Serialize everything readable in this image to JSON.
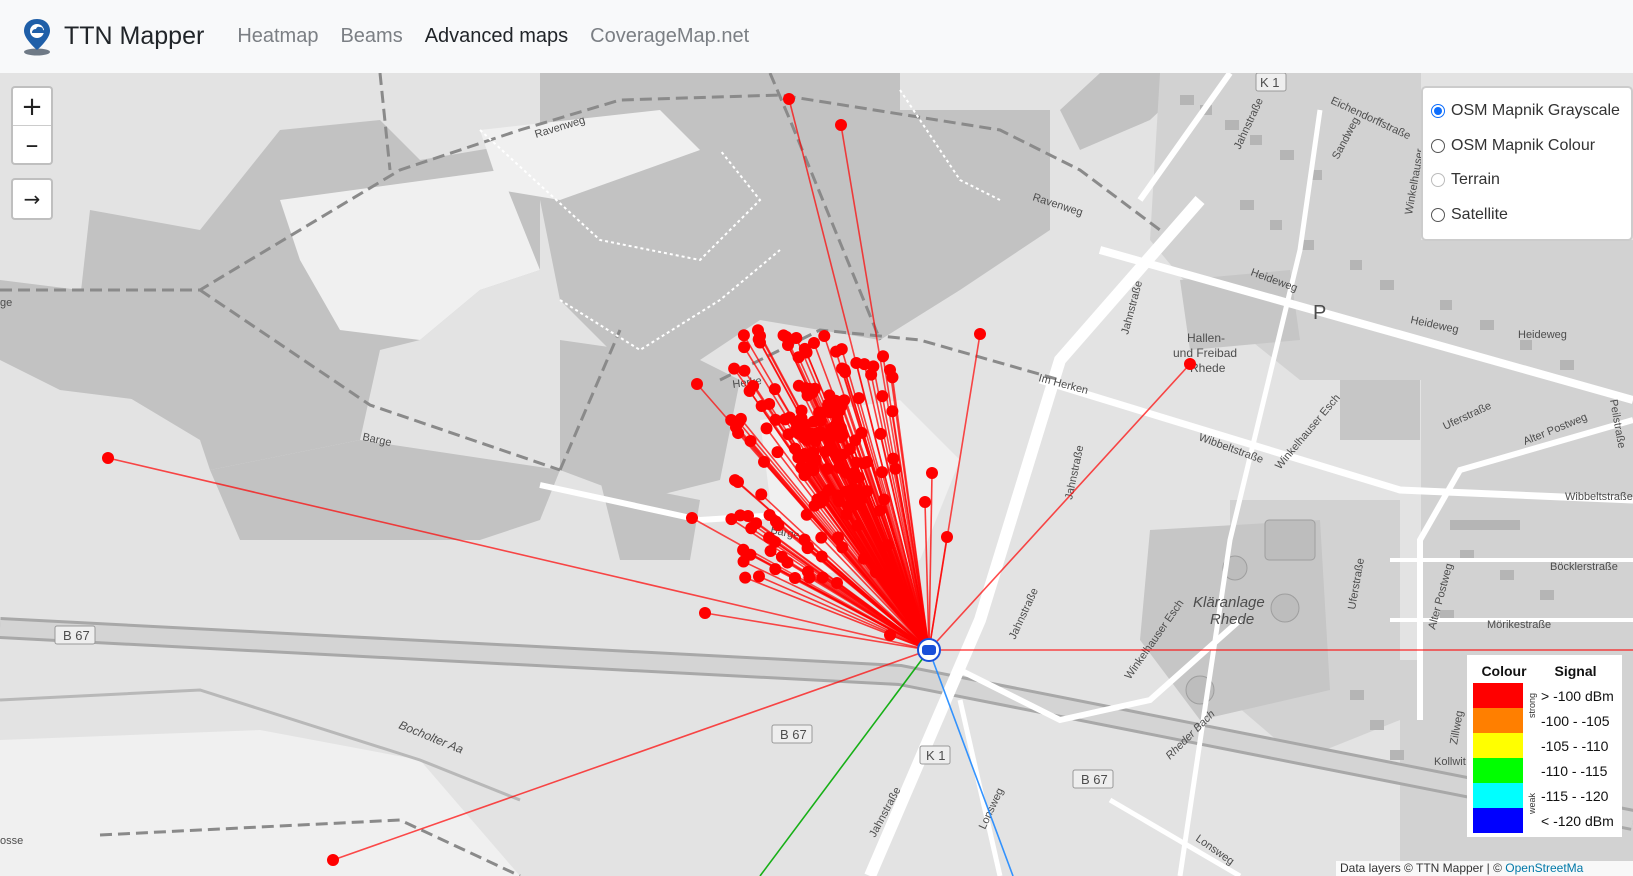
{
  "navbar": {
    "brand": "TTN Mapper",
    "links": [
      {
        "label": "Heatmap",
        "active": false
      },
      {
        "label": "Beams",
        "active": false
      },
      {
        "label": "Advanced maps",
        "active": true
      },
      {
        "label": "CoverageMap.net",
        "active": false
      }
    ]
  },
  "map_controls": {
    "zoom_in": "+",
    "zoom_out": "–",
    "arrow": "→"
  },
  "layers": [
    {
      "label": "OSM Mapnik Grayscale",
      "checked": true
    },
    {
      "label": "OSM Mapnik Colour",
      "checked": false
    },
    {
      "label": "Terrain",
      "checked": false
    },
    {
      "label": "Satellite",
      "checked": false
    }
  ],
  "legend": {
    "colour_header": "Colour",
    "signal_header": "Signal",
    "strong_label": "strong",
    "weak_label": "weak",
    "rows": [
      {
        "color": "#ff0000",
        "label": "> -100 dBm"
      },
      {
        "color": "#ff7f00",
        "label": "-100 - -105"
      },
      {
        "color": "#ffff00",
        "label": "-105 - -110"
      },
      {
        "color": "#00ff00",
        "label": "-110 - -115"
      },
      {
        "color": "#00ffff",
        "label": "-115 - -120"
      },
      {
        "color": "#0000ff",
        "label": "< -120 dBm"
      }
    ]
  },
  "map_labels": {
    "k1_top": "K 1",
    "ravenweg_1": "Ravenweg",
    "ravenweg_2": "Ravenweg",
    "eichendorffstrasse": "Eichendorffstraße",
    "sandweg": "Sandweg",
    "winkelhauser": "Winkelhauser",
    "jahnstrasse_1": "Jahnstraße",
    "jahnstrasse_2": "Jahnstraße",
    "jahnstrasse_3": "Jahnstraße",
    "jahnstrasse_4": "Jahnstraße",
    "jahnstrasse_5": "Jahnstraße",
    "heideweg_1": "Heideweg",
    "heideweg_2": "Heideweg",
    "heideweg_3": "Heideweg",
    "hallen_1": "Hallen-",
    "hallen_2": "und Freibad",
    "hallen_3": "Rhede",
    "im_herken": "Im Herken",
    "herken_left": "Herke",
    "barge_1": "Barge",
    "barge_2": "Barge",
    "wibbeltstrasse_1": "Wibbeltstraße",
    "wibbeltstrasse_2": "Wibbeltstraße",
    "winkelhauser_esch_1": "Winkelhauser Esch",
    "winkelhauser_esch_2": "Winkelhauser Esch",
    "uferstrasse_1": "Uferstraße",
    "uferstrasse_2": "Uferstraße",
    "alter_postweg_1": "Alter Postweg",
    "alter_postweg_2": "Alter Postweg",
    "peilstrasse": "Peilstraße",
    "klaeranlage_1": "Kläranlage",
    "klaeranlage_2": "Rhede",
    "bocklerstrasse": "Böcklerstraße",
    "morikestrasse": "Mörikestraße",
    "b67_1": "B 67",
    "b67_2": "B 67",
    "b67_3": "B 67",
    "k1_bottom": "K 1",
    "bocholter_aa": "Bocholter Aa",
    "rheder_bach": "Rheder Bach",
    "lonsweg_1": "Lonsweg",
    "lonsweg_2": "Lonsweg",
    "zillweg": "Zillweg",
    "kollwit": "Kollwit",
    "parking": "P",
    "osse": "osse",
    "ge": "ge"
  },
  "attribution": {
    "text": "Data layers © TTN Mapper | © ",
    "link": "OpenStreetMa"
  },
  "colors": {
    "strong_signal": "#ff0000",
    "mid_signal": "#00aa00",
    "weak_signal": "#1e88ff",
    "gateway": "#1a4fd8"
  }
}
